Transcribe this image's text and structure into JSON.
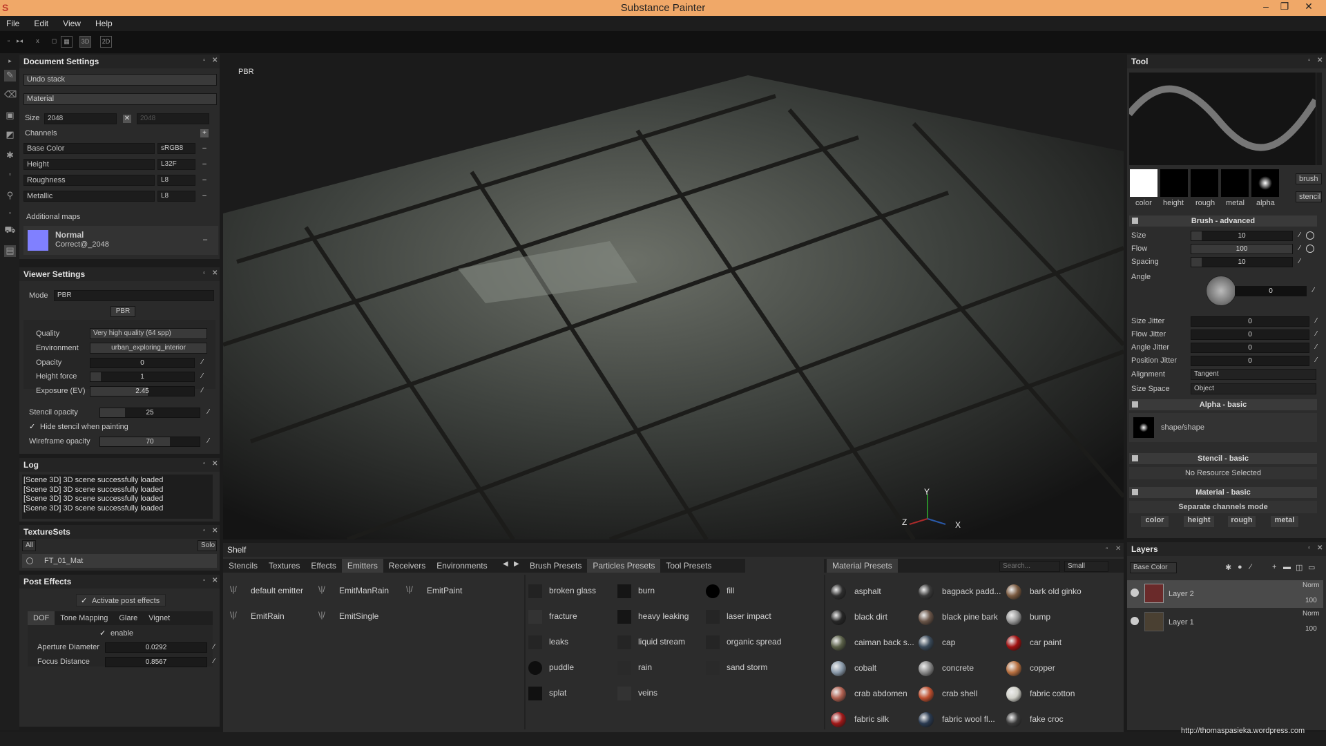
{
  "window": {
    "title": "Substance Painter"
  },
  "menu": [
    "File",
    "Edit",
    "View",
    "Help"
  ],
  "toolbar": {
    "mode3d": "3D",
    "mode2d": "2D"
  },
  "document_settings": {
    "title": "Document Settings",
    "undo": "Undo stack",
    "material": "Material",
    "size_label": "Size",
    "size_w": "2048",
    "size_h": "2048",
    "channels_label": "Channels",
    "channels": [
      {
        "name": "Base Color",
        "format": "sRGB8"
      },
      {
        "name": "Height",
        "format": "L32F"
      },
      {
        "name": "Roughness",
        "format": "L8"
      },
      {
        "name": "Metallic",
        "format": "L8"
      }
    ],
    "additional_maps": "Additional maps",
    "normal_name": "Normal",
    "normal_sub": "Correct@_2048"
  },
  "viewer_settings": {
    "title": "Viewer Settings",
    "mode_label": "Mode",
    "mode_value": "PBR",
    "pbr_button": "PBR",
    "quality_label": "Quality",
    "quality_value": "Very high quality (64 spp)",
    "environment_label": "Environment",
    "environment_value": "urban_exploring_interior",
    "opacity_label": "Opacity",
    "opacity_value": "0",
    "height_force_label": "Height force",
    "height_force_value": "1",
    "exposure_label": "Exposure (EV)",
    "exposure_value": "2.45",
    "stencil_opacity_label": "Stencil opacity",
    "stencil_opacity_value": "25",
    "hide_stencil": "Hide stencil when painting",
    "wireframe_label": "Wireframe opacity",
    "wireframe_value": "70"
  },
  "log": {
    "title": "Log",
    "lines": [
      "[Scene 3D] 3D scene successfully loaded",
      "[Scene 3D] 3D scene successfully loaded",
      "[Scene 3D] 3D scene successfully loaded",
      "[Scene 3D] 3D scene successfully loaded"
    ]
  },
  "texture_sets": {
    "title": "TextureSets",
    "all": "All",
    "solo": "Solo",
    "item": "FT_01_Mat"
  },
  "post_effects": {
    "title": "Post Effects",
    "activate": "Activate post effects",
    "tabs": [
      "DOF",
      "Tone Mapping",
      "Glare",
      "Vignet"
    ],
    "enable": "enable",
    "aperture_label": "Aperture Diameter",
    "aperture_value": "0.0292",
    "focus_label": "Focus Distance",
    "focus_value": "0.8567"
  },
  "viewport": {
    "label": "PBR",
    "axis_y": "Y",
    "axis_x": "X",
    "axis_z": "Z"
  },
  "shelf": {
    "title": "Shelf",
    "left_tabs": [
      "Stencils",
      "Textures",
      "Effects",
      "Emitters",
      "Receivers",
      "Environments"
    ],
    "mid_tabs": [
      "Brush Presets",
      "Particles Presets",
      "Tool Presets"
    ],
    "right_tab": "Material Presets",
    "search_placeholder": "Search...",
    "size": "Small",
    "emitters": [
      "default emitter",
      "EmitManRain",
      "EmitPaint",
      "EmitRain",
      "EmitSingle"
    ],
    "particles": [
      "broken glass",
      "burn",
      "fill",
      "fracture",
      "heavy leaking",
      "laser impact",
      "leaks",
      "liquid stream",
      "organic spread",
      "puddle",
      "rain",
      "sand storm",
      "splat",
      "veins"
    ],
    "materials": [
      {
        "name": "asphalt",
        "color": "#2e2e2e"
      },
      {
        "name": "bagpack padd...",
        "color": "#3a3a3a"
      },
      {
        "name": "bark old ginko",
        "color": "#7a5a40"
      },
      {
        "name": "black dirt",
        "color": "#262626"
      },
      {
        "name": "black pine bark",
        "color": "#6a5548"
      },
      {
        "name": "bump",
        "color": "#9a9a9a"
      },
      {
        "name": "caiman back s...",
        "color": "#5a6048"
      },
      {
        "name": "cap",
        "color": "#3a4a5a"
      },
      {
        "name": "car paint",
        "color": "#a01010"
      },
      {
        "name": "cobalt",
        "color": "#8a9aaa"
      },
      {
        "name": "concrete",
        "color": "#8a8a8a"
      },
      {
        "name": "copper",
        "color": "#b87040"
      },
      {
        "name": "crab abdomen",
        "color": "#b06050"
      },
      {
        "name": "crab shell",
        "color": "#c05030"
      },
      {
        "name": "fabric cotton",
        "color": "#d0d0c8"
      },
      {
        "name": "fabric silk",
        "color": "#a01818"
      },
      {
        "name": "fabric wool fl...",
        "color": "#2a3a50"
      },
      {
        "name": "fake croc",
        "color": "#3a3a3a"
      }
    ]
  },
  "tool": {
    "title": "Tool",
    "swatches": [
      "color",
      "height",
      "rough",
      "metal",
      "alpha"
    ],
    "brush_btn": "brush",
    "stencil_btn": "stencil",
    "brush_advanced": "Brush - advanced",
    "size_label": "Size",
    "size_value": "10",
    "flow_label": "Flow",
    "flow_value": "100",
    "spacing_label": "Spacing",
    "spacing_value": "10",
    "angle_label": "Angle",
    "angle_value": "0",
    "size_jitter_label": "Size Jitter",
    "size_jitter_value": "0",
    "flow_jitter_label": "Flow Jitter",
    "flow_jitter_value": "0",
    "angle_jitter_label": "Angle Jitter",
    "angle_jitter_value": "0",
    "position_jitter_label": "Position Jitter",
    "position_jitter_value": "0",
    "alignment_label": "Alignment",
    "alignment_value": "Tangent",
    "size_space_label": "Size Space",
    "size_space_value": "Object",
    "alpha_basic": "Alpha - basic",
    "alpha_shape": "shape/shape",
    "stencil_basic": "Stencil - basic",
    "no_resource": "No Resource Selected",
    "material_basic": "Material - basic",
    "separate_channels": "Separate channels mode",
    "channels": [
      "color",
      "height",
      "rough",
      "metal"
    ]
  },
  "layers": {
    "title": "Layers",
    "channel": "Base Color",
    "items": [
      {
        "name": "Layer 2",
        "blend": "Norm",
        "opacity": "100"
      },
      {
        "name": "Layer 1",
        "blend": "Norm",
        "opacity": "100"
      }
    ]
  },
  "watermark": "http://thomaspasieka.wordpress.com"
}
